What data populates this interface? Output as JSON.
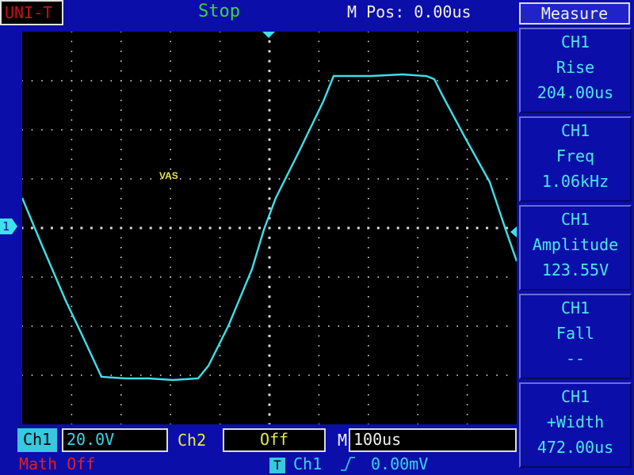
{
  "header": {
    "brand": "UNI-T",
    "run_state": "Stop",
    "m_pos": "M Pos: 0.00us"
  },
  "screen": {
    "annotation": "VAS",
    "channel_marker": "1",
    "colors": {
      "trace": "#3ee0ea",
      "grid": "#d8d8d8"
    }
  },
  "measure": {
    "title": "Measure",
    "items": [
      {
        "channel": "CH1",
        "type": "Rise",
        "value": "204.00us"
      },
      {
        "channel": "CH1",
        "type": "Freq",
        "value": "1.06kHz"
      },
      {
        "channel": "CH1",
        "type": "Amplitude",
        "value": "123.55V"
      },
      {
        "channel": "CH1",
        "type": "Fall",
        "value": "--"
      },
      {
        "channel": "CH1",
        "type": "+Width",
        "value": "472.00us"
      }
    ]
  },
  "status_bar": {
    "ch1_label": "Ch1",
    "ch1_scale": "20.0V",
    "ch2_label": "Ch2",
    "ch2_state": "Off",
    "m_label": "M",
    "timebase": "100us",
    "math": "Math Off",
    "trigger_icon": "T",
    "trigger_source": "Ch1",
    "trigger_edge_icon": "rising-edge",
    "trigger_level": "0.00mV"
  }
}
